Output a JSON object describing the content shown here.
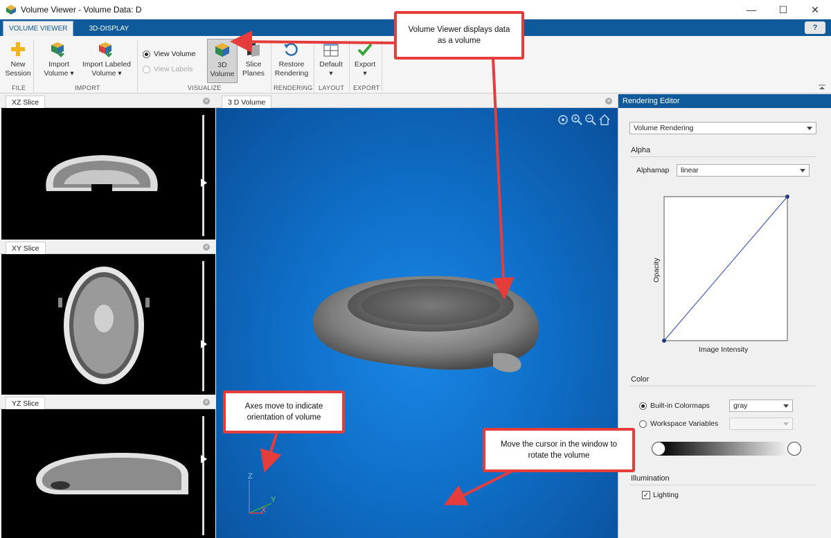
{
  "window": {
    "title": "Volume Viewer - Volume Data: D",
    "minimize": "—",
    "maximize": "☐",
    "close": "✕"
  },
  "tabs": {
    "volume_viewer": "VOLUME VIEWER",
    "display3d": "3D-DISPLAY",
    "help": "?"
  },
  "toolbar": {
    "new_session": [
      "New",
      "Session"
    ],
    "import_volume": [
      "Import",
      "Volume ▾"
    ],
    "import_labeled": [
      "Import Labeled",
      "Volume ▾"
    ],
    "view_volume": "View Volume",
    "view_labels": "View Labels",
    "volume3d": [
      "3D",
      "Volume"
    ],
    "slice_planes": [
      "Slice",
      "Planes"
    ],
    "restore": [
      "Restore",
      "Rendering"
    ],
    "default": [
      "Default",
      "▾"
    ],
    "export": [
      "Export",
      "▾"
    ],
    "groups": {
      "file": "FILE",
      "import": "IMPORT",
      "visualize": "VISUALIZE",
      "rendering": "RENDERING",
      "layout": "LAYOUT",
      "export": "EXPORT"
    }
  },
  "panels": {
    "xz": "XZ Slice",
    "xy": "XY Slice",
    "yz": "YZ Slice",
    "vol": "3 D Volume"
  },
  "axes": {
    "z": "Z",
    "y": "Y",
    "x": "X"
  },
  "editor": {
    "title": "Rendering Editor",
    "mode": "Volume Rendering",
    "alpha_section": "Alpha",
    "alphamap_label": "Alphamap",
    "alphamap_value": "linear",
    "opacity_label": "Opacity",
    "intensity_label": "Image Intensity",
    "color_section": "Color",
    "builtin": "Built-in Colormaps",
    "colormap_value": "gray",
    "workspace": "Workspace Variables",
    "illum_section": "Illumination",
    "lighting": "Lighting"
  },
  "callouts": {
    "volume": "Volume Viewer displays data as a volume",
    "axes": "Axes move to indicate orientation of volume",
    "rotate": "Move the cursor in the window to rotate the volume"
  },
  "colors": {
    "accent": "#0e5a9b",
    "callout_border": "#e53c3c",
    "viewport": "#0f6fc8"
  }
}
